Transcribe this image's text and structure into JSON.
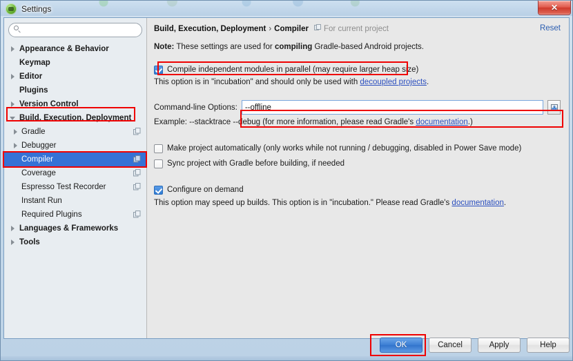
{
  "window": {
    "title": "Settings",
    "icon": "android-studio-icon",
    "close_label": "✕"
  },
  "sidebar": {
    "search": {
      "value": "",
      "placeholder": "",
      "icon": "search-icon"
    },
    "items": [
      {
        "label": "Appearance & Behavior",
        "level": "top",
        "twisty": "collapsed",
        "selected": false,
        "scope_icon": false
      },
      {
        "label": "Keymap",
        "level": "top",
        "twisty": "none",
        "selected": false,
        "scope_icon": false
      },
      {
        "label": "Editor",
        "level": "top",
        "twisty": "collapsed",
        "selected": false,
        "scope_icon": false
      },
      {
        "label": "Plugins",
        "level": "top",
        "twisty": "none",
        "selected": false,
        "scope_icon": false
      },
      {
        "label": "Version Control",
        "level": "top",
        "twisty": "collapsed",
        "selected": false,
        "scope_icon": false
      },
      {
        "label": "Build, Execution, Deployment",
        "level": "top",
        "twisty": "expanded",
        "selected": false,
        "scope_icon": false
      },
      {
        "label": "Gradle",
        "level": "child",
        "twisty": "collapsed",
        "selected": false,
        "scope_icon": true
      },
      {
        "label": "Debugger",
        "level": "child",
        "twisty": "collapsed",
        "selected": false,
        "scope_icon": false
      },
      {
        "label": "Compiler",
        "level": "child",
        "twisty": "none",
        "selected": true,
        "scope_icon": true
      },
      {
        "label": "Coverage",
        "level": "child",
        "twisty": "none",
        "selected": false,
        "scope_icon": true
      },
      {
        "label": "Espresso Test Recorder",
        "level": "child",
        "twisty": "none",
        "selected": false,
        "scope_icon": true
      },
      {
        "label": "Instant Run",
        "level": "child",
        "twisty": "none",
        "selected": false,
        "scope_icon": false
      },
      {
        "label": "Required Plugins",
        "level": "child",
        "twisty": "none",
        "selected": false,
        "scope_icon": true
      },
      {
        "label": "Languages & Frameworks",
        "level": "top",
        "twisty": "collapsed",
        "selected": false,
        "scope_icon": false
      },
      {
        "label": "Tools",
        "level": "top",
        "twisty": "collapsed",
        "selected": false,
        "scope_icon": false
      }
    ]
  },
  "main": {
    "breadcrumb": {
      "parent": "Build, Execution, Deployment",
      "separator": "›",
      "current": "Compiler"
    },
    "scope_note": "For current project",
    "scope_note_icon": "project-scope-icon",
    "reset_label": "Reset",
    "note": {
      "prefix": "Note:",
      "text_1": " These settings are used for ",
      "bold_1": "compiling",
      "text_2": " Gradle-based Android projects."
    },
    "parallel_option": {
      "label": "Compile independent modules in parallel (may require larger heap size)",
      "checked": true,
      "hint_before": "This option is in \"incubation\" and should only be used with ",
      "hint_link": "decoupled projects",
      "hint_after": "."
    },
    "command_line": {
      "label": "Command-line Options:",
      "value": "--offline",
      "placeholder": "",
      "expand_icon": "expand-editor-icon",
      "example_before": "Example: --stacktrace --debug (for more information, please read Gradle's ",
      "example_link": "documentation",
      "example_after": ".)"
    },
    "make_project_option": {
      "label": "Make project automatically (only works while not running / debugging, disabled in Power Save mode)",
      "checked": false
    },
    "sync_project_option": {
      "label": "Sync project with Gradle before building, if needed",
      "checked": false
    },
    "configure_on_demand": {
      "label": "Configure on demand",
      "checked": true,
      "hint_before": "This option may speed up builds. This option is in \"incubation.\" Please read Gradle's ",
      "hint_link": "documentation",
      "hint_after": "."
    }
  },
  "footer": {
    "ok_label": "OK",
    "cancel_label": "Cancel",
    "apply_label": "Apply",
    "help_label": "Help"
  },
  "colors": {
    "selection_blue": "#3572d6",
    "annotation_red": "#ef0000",
    "link_blue": "#2b4fbf",
    "sidebar_bg": "#e8edf1",
    "panel_bg": "#e8e8e8"
  }
}
